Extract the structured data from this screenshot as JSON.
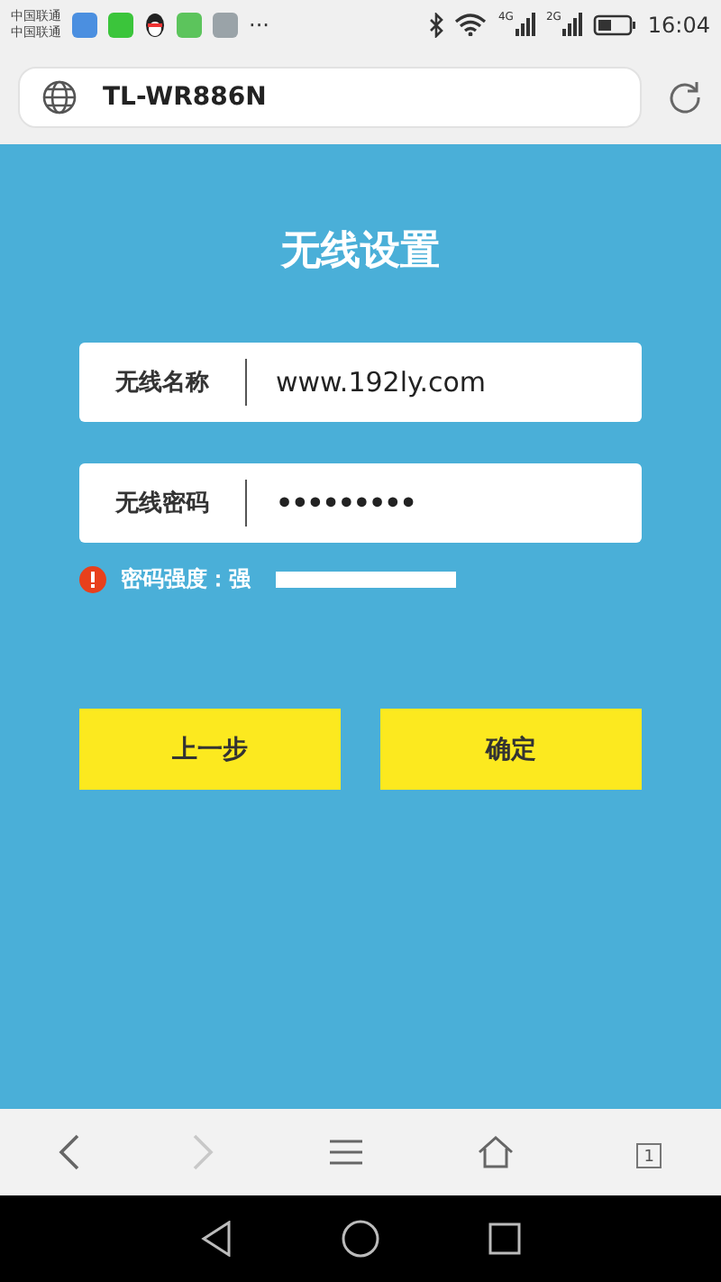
{
  "status_bar": {
    "carriers": [
      "中国联通",
      "中国联通"
    ],
    "more": "···",
    "network_4g": "4G",
    "network_2g": "2G",
    "time": "16:04"
  },
  "address_bar": {
    "url": "TL-WR886N"
  },
  "page": {
    "title": "无线设置",
    "fields": [
      {
        "label": "无线名称",
        "value": "www.192ly.com",
        "kind": "text"
      },
      {
        "label": "无线密码",
        "value": "•••••••••",
        "kind": "password"
      }
    ],
    "strength": {
      "label": "密码强度：强",
      "level": 1
    },
    "buttons": [
      "上一步",
      "确定"
    ]
  },
  "browser_nav": {
    "back_disabled": false,
    "forward_disabled": true,
    "tab_count": "1"
  }
}
